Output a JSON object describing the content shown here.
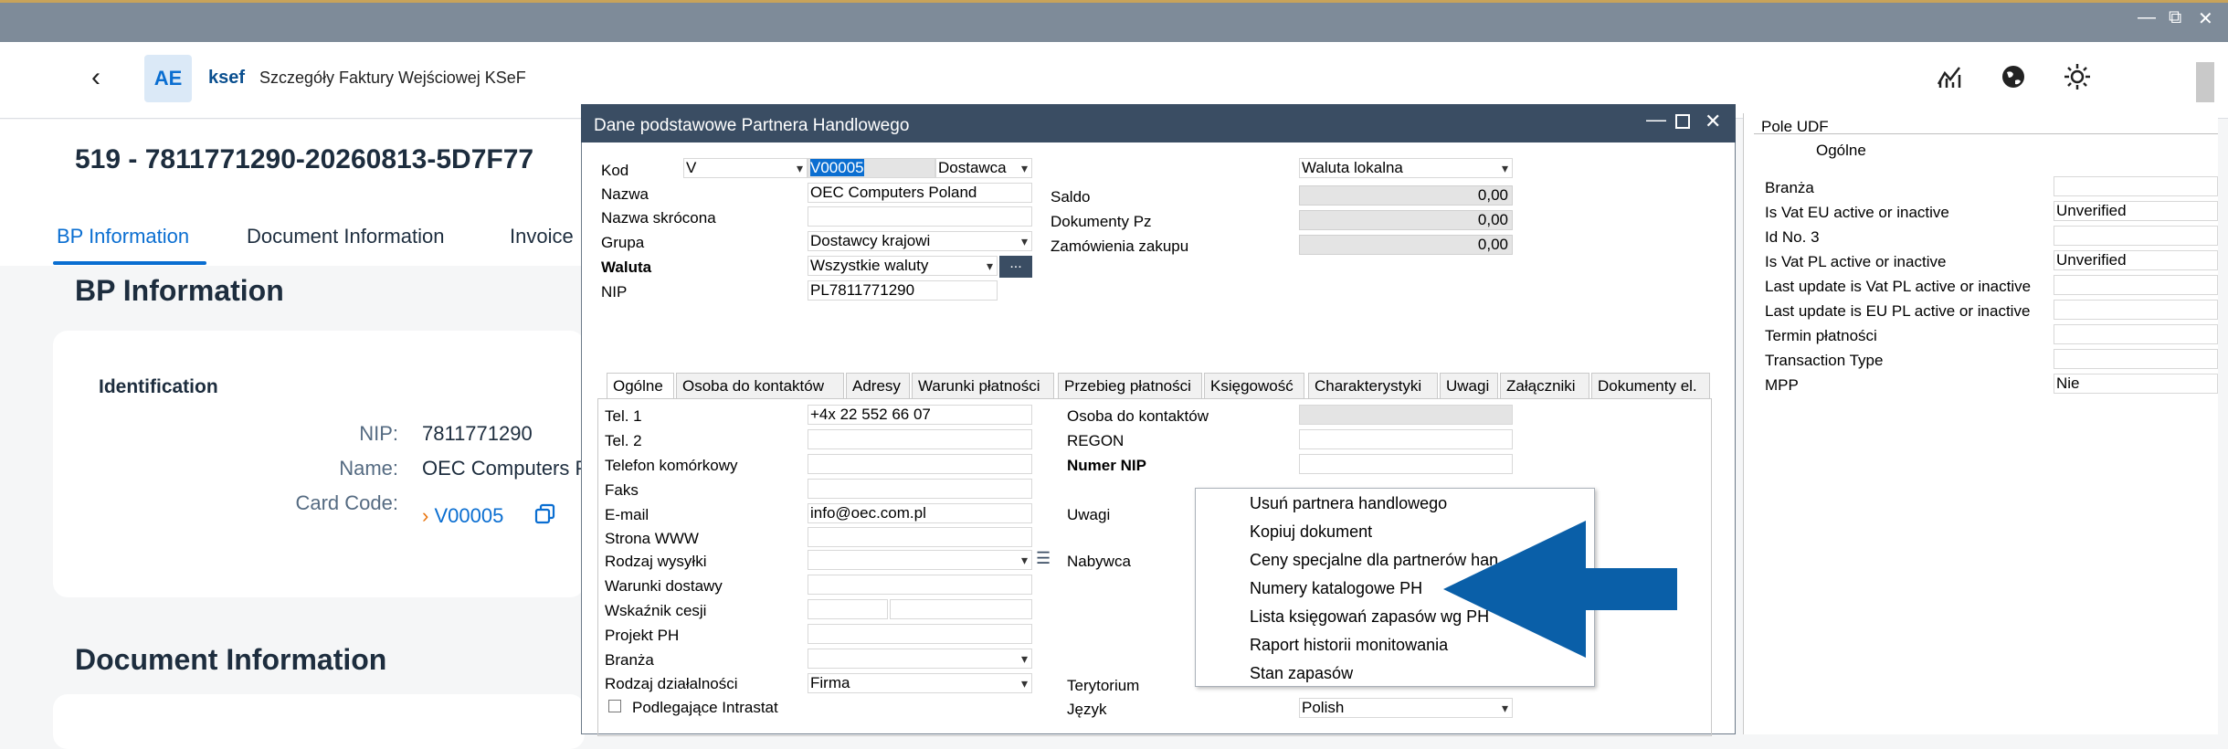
{
  "header": {
    "app_name": "ksef",
    "app_title": "Szczegóły Faktury Wejściowej KSeF",
    "logo_text": "AE",
    "icons": [
      "analytics-icon",
      "globe-icon",
      "theme-sun-icon"
    ]
  },
  "object": {
    "title": "519 - 7811771290-20260813-5D7F77",
    "tabs": [
      "BP Information",
      "Document Information",
      "Invoice"
    ]
  },
  "bp_section": {
    "title": "BP Information",
    "subtitle": "Identification",
    "nip_label": "NIP:",
    "nip_value": "7811771290",
    "name_label": "Name:",
    "name_value": "OEC Computers P",
    "card_label": "Card Code:",
    "card_value": "V00005"
  },
  "doc_section": {
    "title": "Document Information"
  },
  "dialog": {
    "title": "Dane podstawowe Partnera Handlowego",
    "kod_label": "Kod",
    "kod_type": "V",
    "kod_value": "V00005",
    "kod_kind": "Dostawca",
    "nazwa_label": "Nazwa",
    "nazwa_value": "OEC Computers Poland",
    "nazwa_skr_label": "Nazwa skrócona",
    "grupa_label": "Grupa",
    "grupa_value": "Dostawcy krajowi",
    "waluta_label": "Waluta",
    "waluta_value": "Wszystkie waluty",
    "nip_label": "NIP",
    "nip_value": "PL7811771290",
    "ellipsis": "...",
    "waluta_lokalna": "Waluta lokalna",
    "saldo_label": "Saldo",
    "saldo_value": "0,00",
    "dok_pz_label": "Dokumenty Pz",
    "dok_pz_value": "0,00",
    "zamowienia_label": "Zamówienia zakupu",
    "zamowienia_value": "0,00",
    "tabs": [
      "Ogólne",
      "Osoba do kontaktów",
      "Adresy",
      "Warunki płatności",
      "Przebieg płatności",
      "Księgowość",
      "Charakterystyki",
      "Uwagi",
      "Załączniki",
      "Dokumenty el."
    ],
    "left_labels": [
      "Tel. 1",
      "Tel. 2",
      "Telefon komórkowy",
      "Faks",
      "E-mail",
      "Strona WWW",
      "Rodzaj wysyłki",
      "Warunki dostawy",
      "Wskaźnik cesji",
      "Projekt PH",
      "Branża",
      "Rodzaj działalności"
    ],
    "tel1_value": "+4x 22 552 66 07",
    "email_value": "info@oec.com.pl",
    "rodzaj_dzial_value": "Firma",
    "intrastat_label": "Podlegające Intrastat",
    "right_labels": {
      "osoba": "Osoba do kontaktów",
      "regon": "REGON",
      "numer_nip": "Numer NIP",
      "uwagi": "Uwagi",
      "nabywca": "Nabywca",
      "terytorium": "Terytorium",
      "jezyk": "Język"
    },
    "jezyk_value": "Polish"
  },
  "udf_panel": {
    "title": "Pole UDF",
    "category": "Ogólne",
    "rows": [
      {
        "label": "Branża",
        "value": ""
      },
      {
        "label": "Is Vat EU active or inactive",
        "value": "Unverified"
      },
      {
        "label": "Id No. 3",
        "value": ""
      },
      {
        "label": "Is Vat PL active or inactive",
        "value": "Unverified"
      },
      {
        "label": "Last update is Vat PL active or inactive",
        "value": ""
      },
      {
        "label": "Last update is EU PL active or inactive",
        "value": ""
      },
      {
        "label": "Termin płatności",
        "value": ""
      },
      {
        "label": "Transaction Type",
        "value": ""
      },
      {
        "label": "MPP",
        "value": "Nie"
      }
    ]
  },
  "context_menu": {
    "items": [
      "Usuń partnera handlowego",
      "Kopiuj dokument",
      "Ceny specjalne dla partnerów han",
      "Numery katalogowe PH",
      "Lista księgowań zapasów wg PH",
      "Raport historii monitowania",
      "Stan zapasów"
    ]
  },
  "colors": {
    "arrow": "#0a5fa8",
    "dialog_bar": "#3a4d63",
    "accent": "#0a6ed1"
  }
}
